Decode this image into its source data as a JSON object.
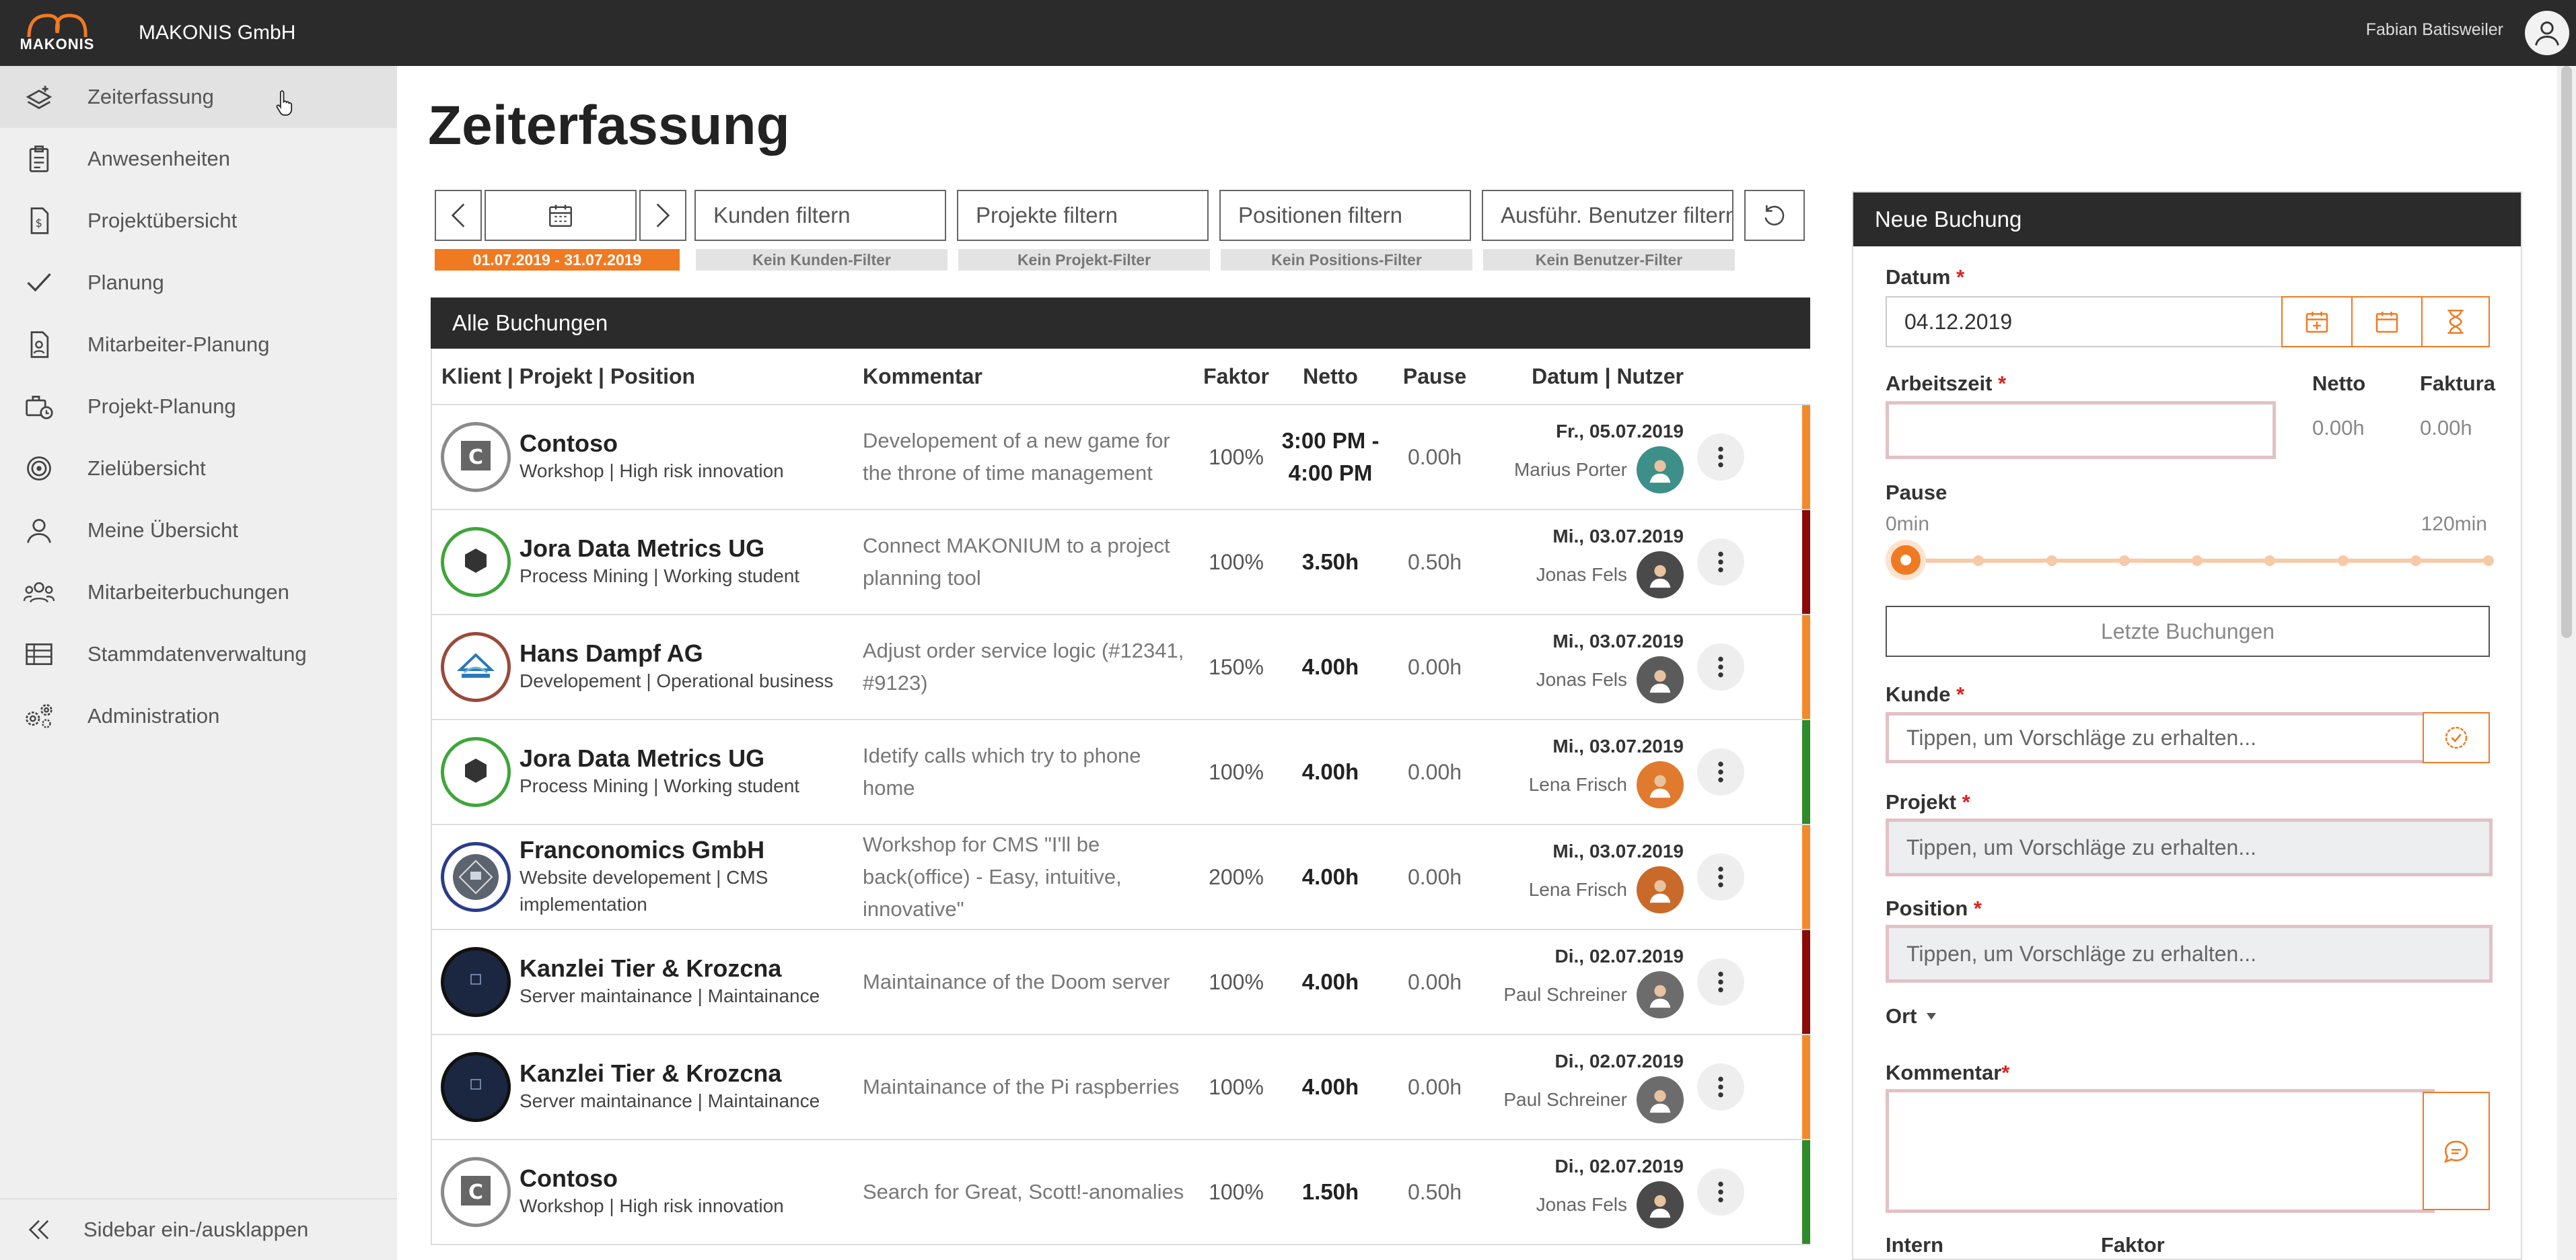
{
  "app": {
    "logo_text": "MAKONIS",
    "company": "MAKONIS GmbH",
    "user_name": "Fabian Batisweiler"
  },
  "sidebar": {
    "items": [
      {
        "label": "Zeiterfassung",
        "icon": "timetrack-icon"
      },
      {
        "label": "Anwesenheiten",
        "icon": "clipboard-icon"
      },
      {
        "label": "Projektübersicht",
        "icon": "project-doc-icon"
      },
      {
        "label": "Planung",
        "icon": "check-icon"
      },
      {
        "label": "Mitarbeiter-Planung",
        "icon": "person-plan-icon"
      },
      {
        "label": "Projekt-Planung",
        "icon": "briefcase-clock-icon"
      },
      {
        "label": "Zielübersicht",
        "icon": "target-icon"
      },
      {
        "label": "Meine Übersicht",
        "icon": "user-icon"
      },
      {
        "label": "Mitarbeiterbuchungen",
        "icon": "users-icon"
      },
      {
        "label": "Stammdatenverwaltung",
        "icon": "table-icon"
      },
      {
        "label": "Administration",
        "icon": "gears-icon"
      }
    ],
    "collapse_label": "Sidebar ein-/ausklappen"
  },
  "main": {
    "title": "Zeiterfassung",
    "filters": {
      "date_range": "01.07.2019 - 31.07.2019",
      "customer_placeholder": "Kunden filtern",
      "project_placeholder": "Projekte filtern",
      "position_placeholder": "Positionen filtern",
      "user_placeholder": "Ausführ. Benutzer filtern",
      "customer_chip": "Kein Kunden-Filter",
      "project_chip": "Kein Projekt-Filter",
      "position_chip": "Kein Positions-Filter",
      "user_chip": "Kein Benutzer-Filter"
    },
    "table": {
      "title": "Alle Buchungen",
      "columns": [
        "Klient | Projekt | Position",
        "Kommentar",
        "Faktor",
        "Netto",
        "Pause",
        "Datum | Nutzer"
      ],
      "rows": [
        {
          "client": "Contoso",
          "sub": "Workshop | High risk innovation",
          "comment": "Developement of a new game for the throne of time management",
          "faktor": "100%",
          "netto": "3:00 PM - 4:00 PM",
          "pause": "0.00h",
          "date": "Fr., 05.07.2019",
          "user": "Marius Porter",
          "stripe": "#f08a2c",
          "logo": "contoso"
        },
        {
          "client": "Jora Data Metrics UG",
          "sub": "Process Mining | Working student",
          "comment": "Connect MAKONIUM to a project planning tool",
          "faktor": "100%",
          "netto": "3.50h",
          "pause": "0.50h",
          "date": "Mi., 03.07.2019",
          "user": "Jonas Fels",
          "stripe": "#8b0a0a",
          "logo": "jora"
        },
        {
          "client": "Hans Dampf AG",
          "sub": "Developement | Operational business",
          "comment": "Adjust order service logic (#12341, #9123)",
          "faktor": "150%",
          "netto": "4.00h",
          "pause": "0.00h",
          "date": "Mi., 03.07.2019",
          "user": "Jonas Fels",
          "stripe": "#f08a2c",
          "logo": "hans"
        },
        {
          "client": "Jora Data Metrics UG",
          "sub": "Process Mining | Working student",
          "comment": "Idetify calls which try to phone home",
          "faktor": "100%",
          "netto": "4.00h",
          "pause": "0.00h",
          "date": "Mi., 03.07.2019",
          "user": "Lena Frisch",
          "stripe": "#2f8a2a",
          "logo": "jora"
        },
        {
          "client": "Franconomics GmbH",
          "sub": "Website developement | CMS implementation",
          "comment": "Workshop for CMS \"I'll be back(office) - Easy, intuitive, innovative\"",
          "faktor": "200%",
          "netto": "4.00h",
          "pause": "0.00h",
          "date": "Mi., 03.07.2019",
          "user": "Lena Frisch",
          "stripe": "#f08a2c",
          "logo": "franc"
        },
        {
          "client": "Kanzlei Tier & Krozcna",
          "sub": "Server maintainance | Maintainance",
          "comment": "Maintainance of the Doom server",
          "faktor": "100%",
          "netto": "4.00h",
          "pause": "0.00h",
          "date": "Di., 02.07.2019",
          "user": "Paul Schreiner",
          "stripe": "#8b0a0a",
          "logo": "kanzlei"
        },
        {
          "client": "Kanzlei Tier & Krozcna",
          "sub": "Server maintainance | Maintainance",
          "comment": "Maintainance of the Pi raspberries",
          "faktor": "100%",
          "netto": "4.00h",
          "pause": "0.00h",
          "date": "Di., 02.07.2019",
          "user": "Paul Schreiner",
          "stripe": "#f08a2c",
          "logo": "kanzlei"
        },
        {
          "client": "Contoso",
          "sub": "Workshop | High risk innovation",
          "comment": "Search for Great, Scott!-anomalies",
          "faktor": "100%",
          "netto": "1.50h",
          "pause": "0.50h",
          "date": "Di., 02.07.2019",
          "user": "Jonas Fels",
          "stripe": "#2f8a2a",
          "logo": "contoso"
        }
      ]
    }
  },
  "booking_panel": {
    "title": "Neue Buchung",
    "datum_label": "Datum",
    "datum_value": "04.12.2019",
    "arbeitszeit_label": "Arbeitszeit",
    "netto_label": "Netto",
    "netto_value": "0.00h",
    "faktura_label": "Faktura",
    "faktura_value": "0.00h",
    "pause_label": "Pause",
    "pause_min": "0min",
    "pause_max": "120min",
    "pause_value_fraction": 0,
    "letzte_buchungen_label": "Letzte Buchungen",
    "kunde_label": "Kunde",
    "kunde_placeholder": "Tippen, um Vorschläge zu erhalten...",
    "projekt_label": "Projekt",
    "projekt_placeholder": "Tippen, um Vorschläge zu erhalten...",
    "position_label": "Position",
    "position_placeholder": "Tippen, um Vorschläge zu erhalten...",
    "ort_label": "Ort",
    "kommentar_label": "Kommentar",
    "intern_label": "Intern",
    "faktor_label": "Faktor",
    "required_mark": "*"
  },
  "colors": {
    "accent": "#f07a22",
    "topbar": "#2b2b2b",
    "required": "#e0201c"
  }
}
